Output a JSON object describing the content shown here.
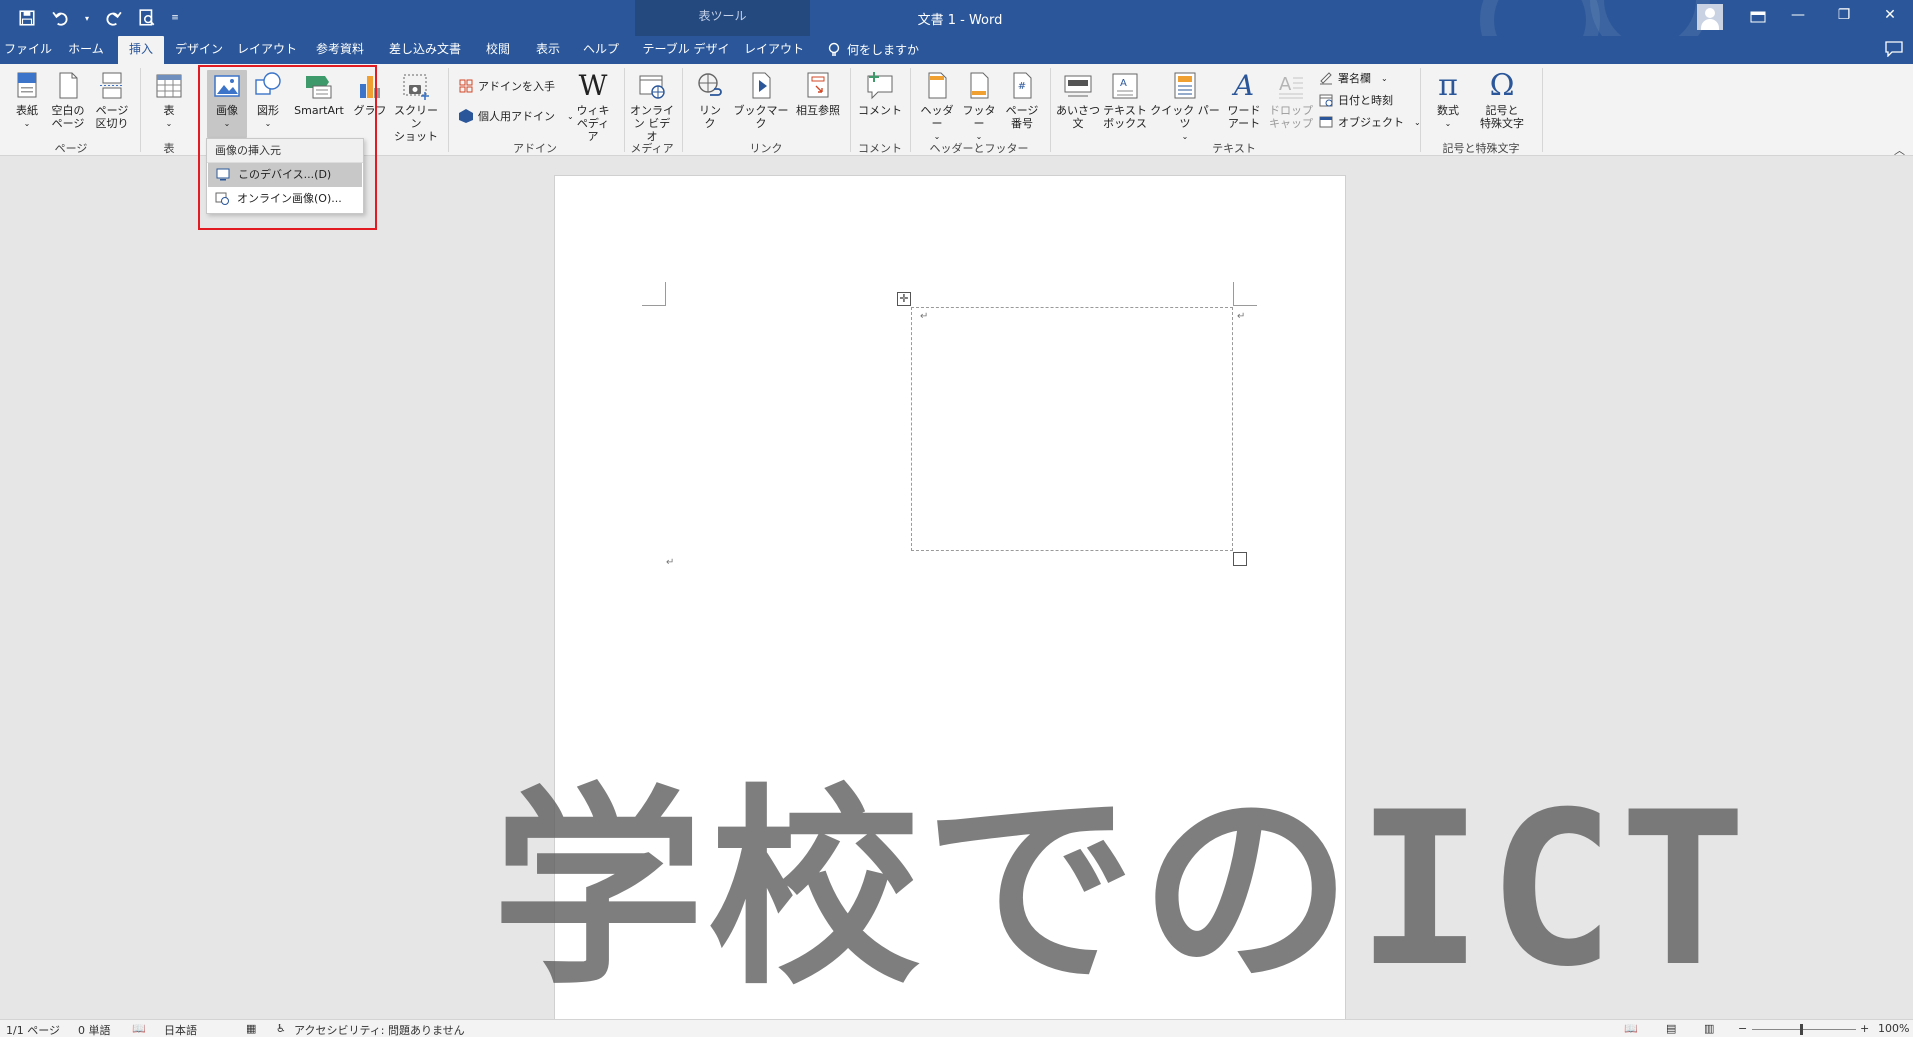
{
  "app": {
    "doc_title": "文書 1  -  Word",
    "context_tab_title": "表ツール"
  },
  "tabs": [
    {
      "label": "ファイル"
    },
    {
      "label": "ホーム"
    },
    {
      "label": "挿入"
    },
    {
      "label": "デザイン"
    },
    {
      "label": "レイアウト"
    },
    {
      "label": "参考資料"
    },
    {
      "label": "差し込み文書"
    },
    {
      "label": "校閲"
    },
    {
      "label": "表示"
    },
    {
      "label": "ヘルプ"
    },
    {
      "label": "テーブル デザイン"
    },
    {
      "label": "レイアウト"
    }
  ],
  "tell_me": "何をしますか",
  "ribbon": {
    "page_group": {
      "label": "ページ",
      "cover": "表紙",
      "blank_1": "空白の",
      "blank_2": "ページ",
      "break_1": "ページ",
      "break_2": "区切り"
    },
    "table_group": {
      "label": "表",
      "table": "表"
    },
    "illus": {
      "picture": "画像",
      "shapes": "図形",
      "smartart": "SmartArt",
      "chart": "グラフ",
      "screenshot_1": "スクリーン",
      "screenshot_2": "ショット"
    },
    "addin_group": {
      "label": "アドイン",
      "get": "アドインを入手",
      "my": "個人用アドイン",
      "wiki_1": "ウィキ",
      "wiki_2": "ペディア"
    },
    "media_group": {
      "label": "メディア",
      "video_1": "オンライ",
      "video_2": "ン ビデオ"
    },
    "link_group": {
      "label": "リンク",
      "link_1": "リン",
      "link_2": "ク",
      "bookmark": "ブックマーク",
      "crossref": "相互参照"
    },
    "comment_group": {
      "label": "コメント",
      "comment": "コメント"
    },
    "hf_group": {
      "label": "ヘッダーとフッター",
      "header": "ヘッダー",
      "footer": "フッター",
      "pagenum_1": "ページ",
      "pagenum_2": "番号"
    },
    "text_group": {
      "label": "テキスト",
      "greeting_1": "あいさつ",
      "greeting_2": "文",
      "textbox_1": "テキスト",
      "textbox_2": "ボックス",
      "quickparts": "クイック パーツ",
      "wordart_1": "ワード",
      "wordart_2": "アート",
      "dropcap_1": "ドロップ",
      "dropcap_2": "キャップ",
      "signature": "署名欄",
      "datetime": "日付と時刻",
      "object": "オブジェクト"
    },
    "symbol_group": {
      "label": "記号と特殊文字",
      "equation": "数式",
      "symbol_1": "記号と",
      "symbol_2": "特殊文字"
    }
  },
  "picture_menu": {
    "header": "画像の挿入元",
    "items": [
      {
        "label": "このデバイス...(D)"
      },
      {
        "label": "オンライン画像(O)..."
      }
    ]
  },
  "watermark_text": "学校でのICT",
  "status": {
    "page": "1/1 ページ",
    "words": "0 単語",
    "language": "日本語",
    "accessibility": "アクセシビリティ: 問題ありません",
    "zoom": "100%"
  },
  "colors": {
    "accent": "#2b579a",
    "highlight": "#e21a22"
  }
}
